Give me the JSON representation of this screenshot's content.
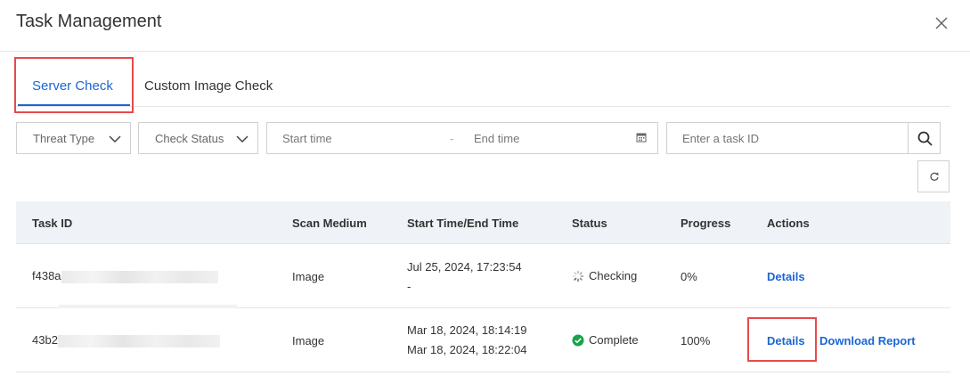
{
  "dialog": {
    "title": "Task Management",
    "close_icon": "close-icon"
  },
  "tabs": [
    {
      "label": "Server Check",
      "active": true
    },
    {
      "label": "Custom Image Check",
      "active": false
    }
  ],
  "filters": {
    "threat_type": "Threat Type",
    "check_status": "Check Status",
    "start_time": "Start time",
    "range_separator": "-",
    "end_time": "End time",
    "task_id_placeholder": "Enter a task ID"
  },
  "table": {
    "headers": [
      "Task ID",
      "Scan Medium",
      "Start Time/End Time",
      "Status",
      "Progress",
      "Actions"
    ],
    "rows": [
      {
        "task_id": "f438a",
        "scan_medium": "Image",
        "start_time": "Jul 25, 2024, 17:23:54",
        "end_time": "-",
        "status": "Checking",
        "status_icon": "spinner-icon",
        "progress": "0%",
        "actions": [
          "Details"
        ]
      },
      {
        "task_id": "43b2",
        "scan_medium": "Image",
        "start_time": "Mar 18, 2024, 18:14:19",
        "end_time": "Mar 18, 2024, 18:22:04",
        "status": "Complete",
        "status_icon": "check-circle-icon",
        "progress": "100%",
        "actions": [
          "Details",
          "Download Report"
        ]
      }
    ]
  },
  "colors": {
    "accent": "#1a66d6",
    "success": "#1aa34a",
    "highlight": "#e84a4a"
  }
}
